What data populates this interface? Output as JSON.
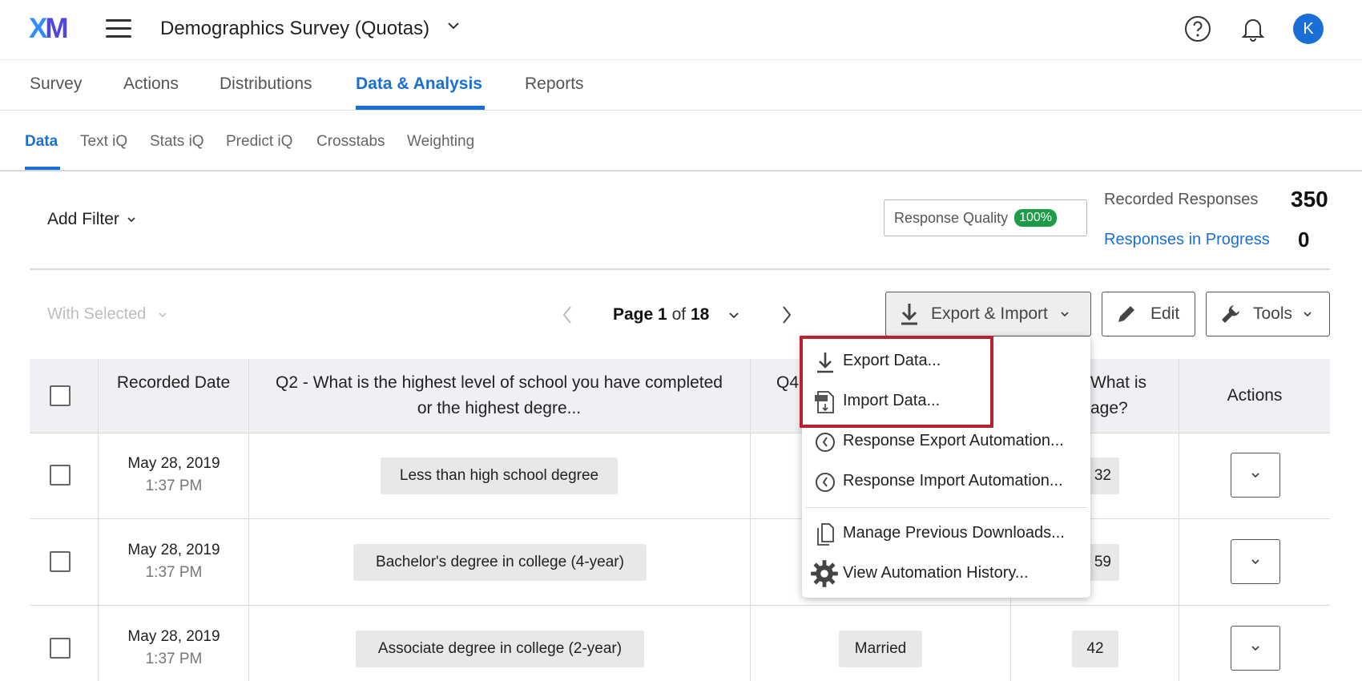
{
  "header": {
    "logo_x": "X",
    "logo_m": "M",
    "survey_title": "Demographics Survey (Quotas)",
    "avatar_initial": "K"
  },
  "main_tabs": [
    "Survey",
    "Actions",
    "Distributions",
    "Data & Analysis",
    "Reports"
  ],
  "active_main_tab": "Data & Analysis",
  "sub_tabs": [
    "Data",
    "Text iQ",
    "Stats iQ",
    "Predict iQ",
    "Crosstabs",
    "Weighting"
  ],
  "active_sub_tab": "Data",
  "filters": {
    "add_filter_label": "Add Filter"
  },
  "response_quality": {
    "label": "Response Quality",
    "value": "100%"
  },
  "stats": {
    "recorded_label": "Recorded Responses",
    "recorded_value": "350",
    "in_progress_label": "Responses in Progress",
    "in_progress_value": "0"
  },
  "toolbar": {
    "with_selected": "With Selected",
    "page_word": "Page",
    "page_current": "1",
    "page_of": "of",
    "page_total": "18",
    "export_import": "Export & Import",
    "edit": "Edit",
    "tools": "Tools"
  },
  "table": {
    "headers": {
      "recorded_date": "Recorded Date",
      "q2": "Q2 - What is the highest level of school you have completed or the highest degre...",
      "q4_partial": "Q4",
      "age_partial": "What is\nage?",
      "actions": "Actions"
    },
    "rows": [
      {
        "date": "May 28, 2019",
        "time": "1:37 PM",
        "q2": "Less than high school degree",
        "q4": "",
        "age": "32"
      },
      {
        "date": "May 28, 2019",
        "time": "1:37 PM",
        "q2": "Bachelor's degree in college (4-year)",
        "q4": "",
        "age": "59"
      },
      {
        "date": "May 28, 2019",
        "time": "1:37 PM",
        "q2": "Associate degree in college (2-year)",
        "q4": "Married",
        "age": "42"
      }
    ]
  },
  "export_menu": {
    "items": [
      {
        "label": "Export Data...",
        "icon": "download-icon"
      },
      {
        "label": "Import Data...",
        "icon": "csv-file-icon"
      },
      {
        "label": "Response Export Automation...",
        "icon": "clock-icon"
      },
      {
        "label": "Response Import Automation...",
        "icon": "clock-icon"
      },
      {
        "label": "Manage Previous Downloads...",
        "icon": "files-icon"
      },
      {
        "label": "View Automation History...",
        "icon": "gear-icon"
      }
    ]
  },
  "colors": {
    "accent": "#1a6fd6",
    "quality_badge": "#1e9b48",
    "highlight_box": "#b8212f"
  }
}
